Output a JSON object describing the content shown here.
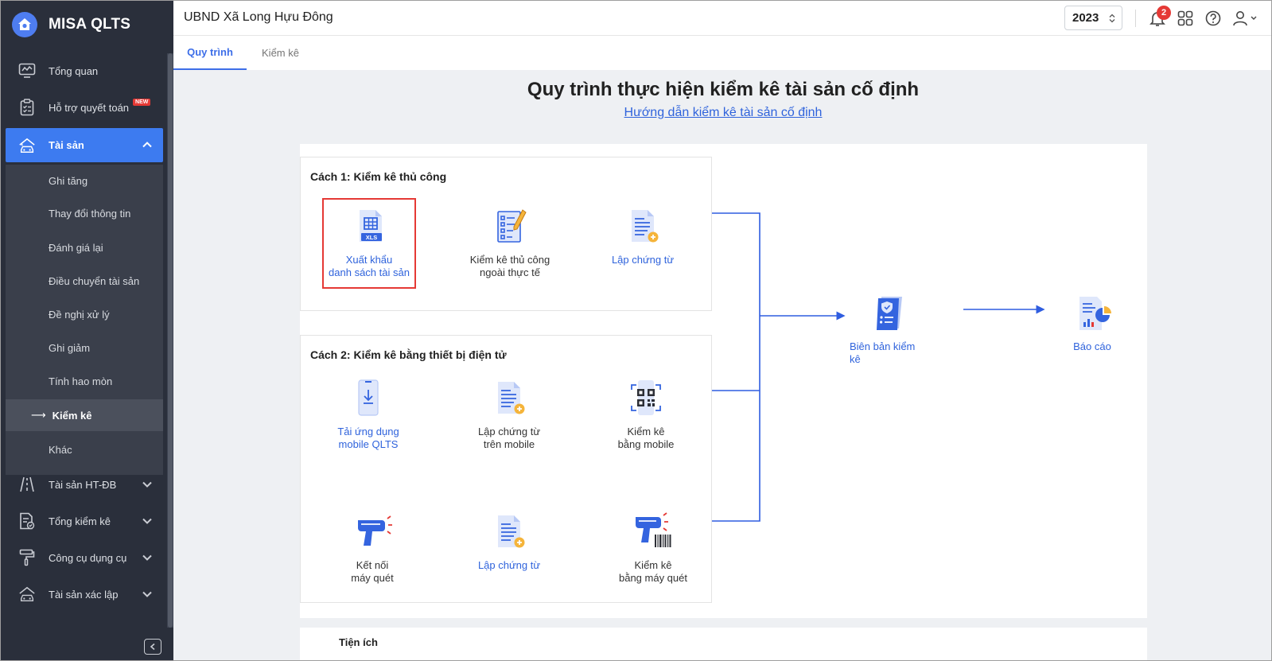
{
  "app": {
    "name": "MISA QLTS"
  },
  "sidebar": {
    "items": [
      {
        "label": "Tổng quan"
      },
      {
        "label": "Hỗ trợ quyết toán",
        "badge": "NEW"
      },
      {
        "label": "Tài sản"
      },
      {
        "label": "Tài sản HT-ĐB"
      },
      {
        "label": "Tổng kiểm kê"
      },
      {
        "label": "Công cụ dụng cụ"
      },
      {
        "label": "Tài sản xác lập"
      }
    ],
    "subitems": [
      {
        "label": "Ghi tăng"
      },
      {
        "label": "Thay đổi thông tin"
      },
      {
        "label": "Đánh giá lại"
      },
      {
        "label": "Điều chuyển tài sản"
      },
      {
        "label": "Đề nghị xử lý"
      },
      {
        "label": "Ghi giảm"
      },
      {
        "label": "Tính hao mòn"
      },
      {
        "label": "Kiểm kê"
      },
      {
        "label": "Khác"
      }
    ]
  },
  "header": {
    "org_name": "UBND Xã Long Hựu Đông",
    "year": "2023",
    "notification_count": "2"
  },
  "tabs": [
    {
      "label": "Quy trình"
    },
    {
      "label": "Kiểm kê"
    }
  ],
  "main": {
    "title": "Quy trình thực hiện kiểm kê tài sản cố định",
    "guide_link": "Hướng dẫn kiểm kê tài sản cố định",
    "method1": {
      "title": "Cách 1: Kiểm kê thủ công",
      "steps": [
        {
          "line1": "Xuất khẩu",
          "line2": "danh sách tài sản",
          "icon": "xls-file-icon"
        },
        {
          "line1": "Kiểm kê thủ công",
          "line2": "ngoài thực tế",
          "icon": "checklist-pen-icon"
        },
        {
          "line1": "Lập chứng từ",
          "line2": "",
          "icon": "document-add-icon"
        }
      ],
      "xls_tag": "XLS"
    },
    "method2": {
      "title": "Cách 2: Kiểm kê bằng thiết bị điện tử",
      "row1": [
        {
          "line1": "Tải ứng dụng",
          "line2": "mobile QLTS",
          "icon": "mobile-download-icon"
        },
        {
          "line1": "Lập chứng từ",
          "line2": "trên mobile",
          "icon": "document-add-icon"
        },
        {
          "line1": "Kiểm kê",
          "line2": "bằng mobile",
          "icon": "qr-scan-icon"
        }
      ],
      "row2": [
        {
          "line1": "Kết nối",
          "line2": "máy quét",
          "icon": "barcode-scanner-icon"
        },
        {
          "line1": "Lập chứng từ",
          "line2": "",
          "icon": "document-add-icon"
        },
        {
          "line1": "Kiểm kê",
          "line2": "bằng máy quét",
          "icon": "scanner-barcode-icon"
        }
      ]
    },
    "result": [
      {
        "line1": "Biên bản kiểm",
        "line2": "kê",
        "icon": "report-shield-icon"
      },
      {
        "line1": "Báo cáo",
        "line2": "",
        "icon": "report-chart-icon"
      }
    ],
    "utility_title": "Tiện ích"
  },
  "colors": {
    "accent": "#3d7bf0",
    "link": "#2f63dc",
    "sidebar_bg": "#2a2f3b",
    "highlight": "#e53935"
  }
}
